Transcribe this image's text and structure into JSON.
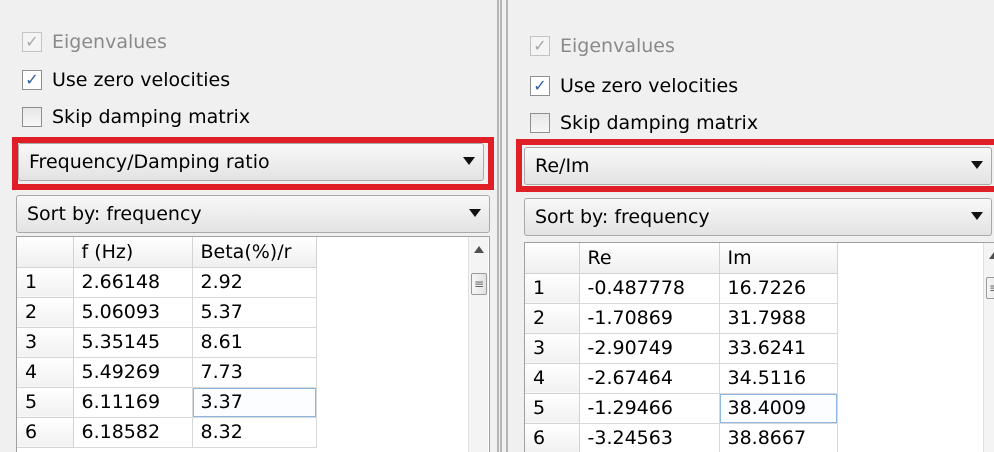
{
  "left": {
    "eigenvalues_label": "Eigenvalues",
    "use_zero_velocities_label": "Use zero velocities",
    "skip_damping_label": "Skip damping matrix",
    "display_mode": "Frequency/Damping ratio",
    "sort_by": "Sort by: frequency",
    "columns": [
      "",
      "f (Hz)",
      "Beta(%)/r"
    ],
    "rows": [
      [
        "1",
        "2.66148",
        "2.92"
      ],
      [
        "2",
        "5.06093",
        "5.37"
      ],
      [
        "3",
        "5.35145",
        "8.61"
      ],
      [
        "4",
        "5.49269",
        "7.73"
      ],
      [
        "5",
        "6.11169",
        "3.37"
      ],
      [
        "6",
        "6.18582",
        "8.32"
      ]
    ]
  },
  "right": {
    "eigenvalues_label": "Eigenvalues",
    "use_zero_velocities_label": "Use zero velocities",
    "skip_damping_label": "Skip damping matrix",
    "display_mode": "Re/Im",
    "sort_by": "Sort by: frequency",
    "columns": [
      "",
      "Re",
      "Im"
    ],
    "rows": [
      [
        "1",
        "-0.487778",
        "16.7226"
      ],
      [
        "2",
        "-1.70869",
        "31.7988"
      ],
      [
        "3",
        "-2.90749",
        "33.6241"
      ],
      [
        "4",
        "-2.67464",
        "34.5116"
      ],
      [
        "5",
        "-1.29466",
        "38.4009"
      ],
      [
        "6",
        "-3.24563",
        "38.8667"
      ]
    ]
  },
  "icons": {
    "checkmark": "✓",
    "scroll_thumb_grip": "≡"
  },
  "colors": {
    "highlight_box": "#e01e26",
    "selected_cell_border": "#8fb8e0",
    "checkbox_mark": "#2f5f9e"
  }
}
